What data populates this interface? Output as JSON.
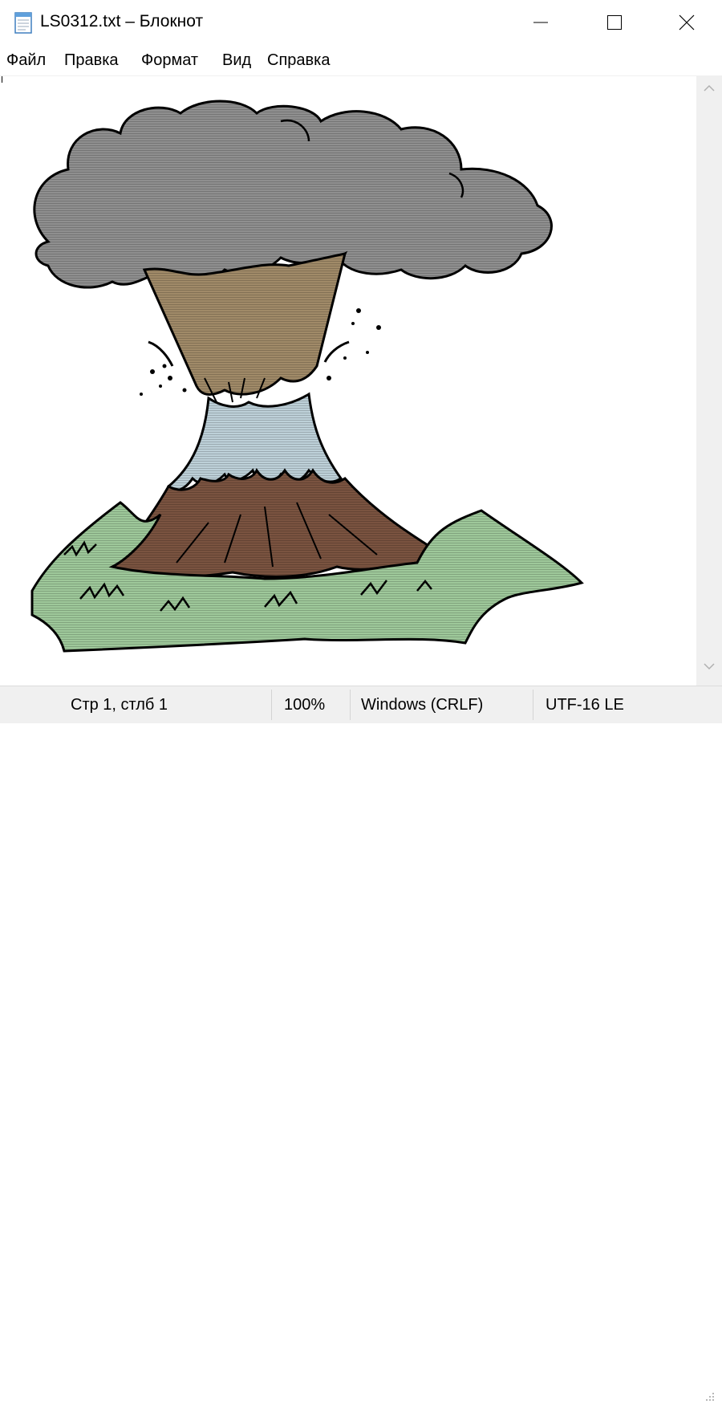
{
  "window": {
    "title": "LS0312.txt – Блокнот",
    "app_icon": "notepad-icon",
    "controls": [
      "minimize-icon",
      "maximize-icon",
      "close-icon"
    ]
  },
  "menu": {
    "items": [
      "Файл",
      "Правка",
      "Формат",
      "Вид",
      "Справка"
    ]
  },
  "editor": {
    "content_description": "volcano-ascii-art"
  },
  "status": {
    "position": "Стр 1, стлб 1",
    "zoom": "100%",
    "line_endings": "Windows (CRLF)",
    "encoding": "UTF-16 LE"
  },
  "colors": {
    "smoke": "#8f8f8f",
    "cone_tan": "#a08a68",
    "lava_light": "#bdd0d8",
    "mountain_brown": "#7a5340",
    "grass_green": "#9ec89a"
  }
}
